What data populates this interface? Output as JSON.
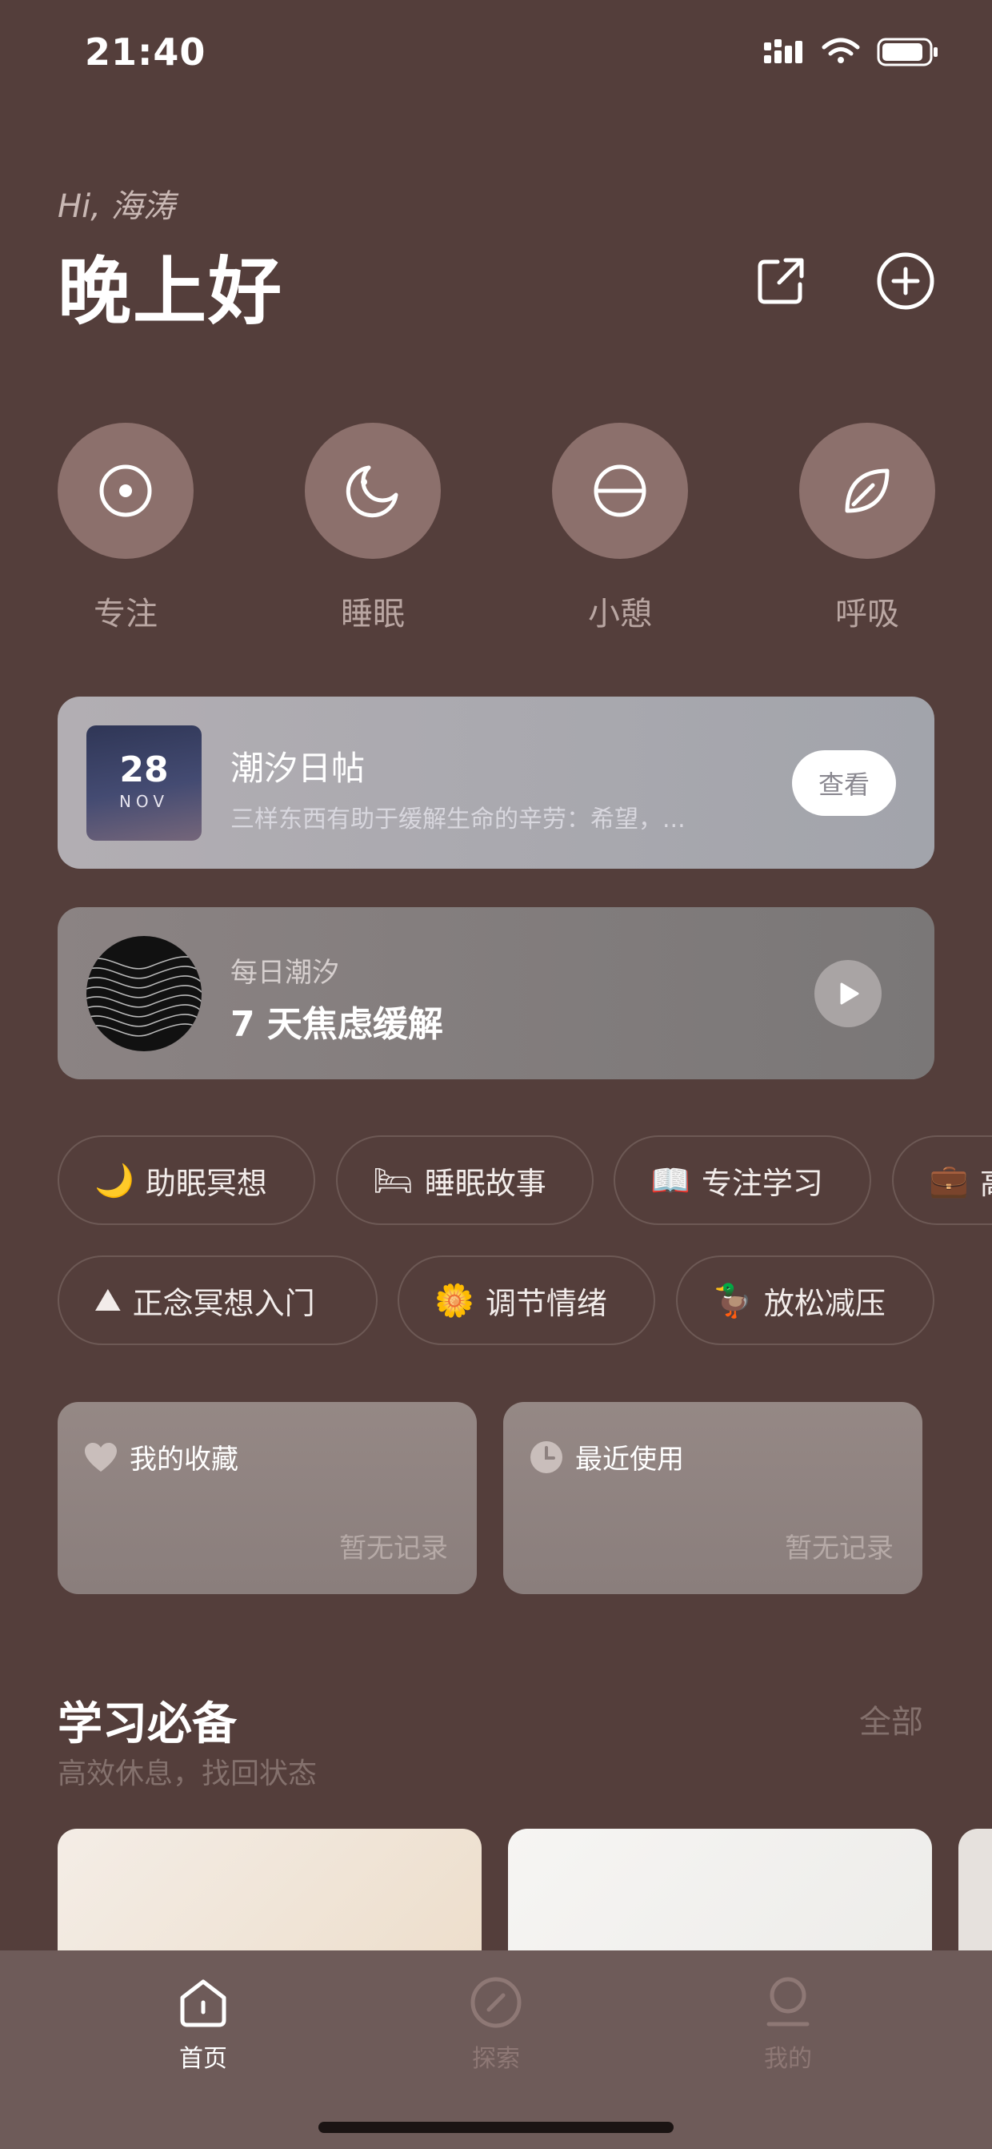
{
  "status_bar": {
    "time": "21:40"
  },
  "header": {
    "greeting": "Hi, 海涛",
    "title": "晚上好",
    "share_icon": "share-icon",
    "add_icon": "plus-circle-icon"
  },
  "modes": [
    {
      "label": "专注",
      "icon": "focus-target-icon"
    },
    {
      "label": "睡眠",
      "icon": "moon-icon"
    },
    {
      "label": "小憩",
      "icon": "half-circle-icon"
    },
    {
      "label": "呼吸",
      "icon": "leaf-icon"
    }
  ],
  "daily_card": {
    "day": "28",
    "month": "NOV",
    "title": "潮汐日帖",
    "subtitle": "三样东西有助于缓解生命的辛劳：希望，...",
    "button": "查看"
  },
  "player_card": {
    "label": "每日潮汐",
    "title": "7 天焦虑缓解",
    "play_icon": "play-icon"
  },
  "chips_row1": [
    {
      "emoji": "🌙",
      "label": "助眠冥想"
    },
    {
      "emoji": "🛏",
      "label": "睡眠故事"
    },
    {
      "emoji": "📖",
      "label": "专注学习"
    },
    {
      "emoji": "💼",
      "label": "高"
    }
  ],
  "chips_row2": [
    {
      "emoji": "⛰",
      "label": "正念冥想入门"
    },
    {
      "emoji": "🌼",
      "label": "调节情绪"
    },
    {
      "emoji": "🦆",
      "label": "放松减压"
    }
  ],
  "collections": {
    "favorites": {
      "title": "我的收藏",
      "empty": "暂无记录",
      "icon": "heart-icon"
    },
    "recent": {
      "title": "最近使用",
      "empty": "暂无记录",
      "icon": "clock-icon"
    }
  },
  "section": {
    "title": "学习必备",
    "subtitle": "高效休息，找回状态",
    "all": "全部"
  },
  "tabbar": {
    "tabs": [
      {
        "label": "首页",
        "icon": "home-icon",
        "active": true
      },
      {
        "label": "探索",
        "icon": "compass-icon",
        "active": false
      },
      {
        "label": "我的",
        "icon": "profile-icon",
        "active": false
      }
    ]
  },
  "colors": {
    "background": "#543e3b",
    "mode_circle": "#8c706c",
    "tabbar": "#6e5b59",
    "muted_text": "#84716d"
  }
}
